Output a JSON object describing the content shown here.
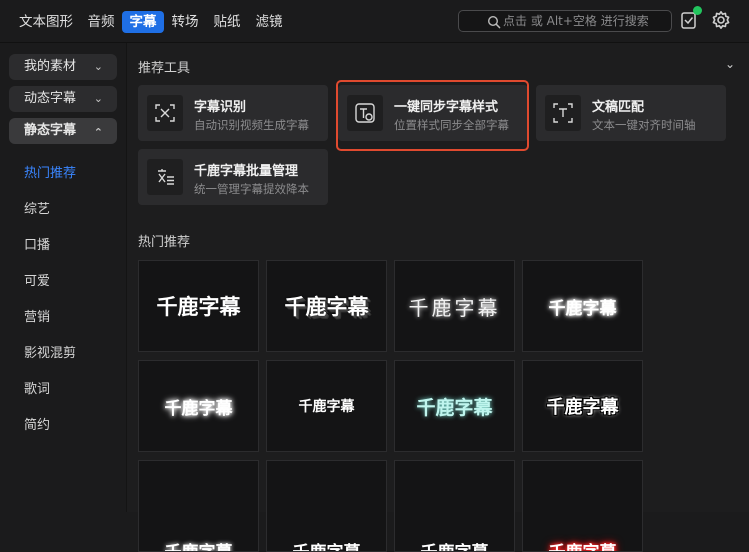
{
  "topbar": {
    "tabs": [
      {
        "label": "文本图形",
        "active": false
      },
      {
        "label": "音频",
        "active": false
      },
      {
        "label": "字幕",
        "active": true
      },
      {
        "label": "转场",
        "active": false
      },
      {
        "label": "贴纸",
        "active": false
      },
      {
        "label": "滤镜",
        "active": false
      }
    ],
    "search_placeholder": "点击 或 Alt+空格 进行搜索",
    "icons": [
      "search-icon",
      "task-check-icon",
      "settings-icon"
    ],
    "accent": "#1f6fe5",
    "badge_color": "#22c55e"
  },
  "sidebar": {
    "categories": [
      {
        "label": "我的素材",
        "expanded": false
      },
      {
        "label": "动态字幕",
        "expanded": false
      },
      {
        "label": "静态字幕",
        "expanded": true
      }
    ],
    "subitems": [
      {
        "label": "热门推荐",
        "active": true
      },
      {
        "label": "综艺",
        "active": false
      },
      {
        "label": "口播",
        "active": false
      },
      {
        "label": "可爱",
        "active": false
      },
      {
        "label": "营销",
        "active": false
      },
      {
        "label": "影视混剪",
        "active": false
      },
      {
        "label": "歌词",
        "active": false
      },
      {
        "label": "简约",
        "active": false
      }
    ],
    "active_color": "#3a86ff"
  },
  "main": {
    "tools_title": "推荐工具",
    "tools": [
      {
        "name": "字幕识别",
        "desc": "自动识别视频生成字幕",
        "icon": "subtitle-recognize-icon"
      },
      {
        "name": "一键同步字幕样式",
        "desc": "位置样式同步全部字幕",
        "icon": "sync-style-icon",
        "highlighted": true
      },
      {
        "name": "文稿匹配",
        "desc": "文本一键对齐时间轴",
        "icon": "text-match-icon"
      },
      {
        "name": "千鹿字幕批量管理",
        "desc": "统一管理字幕提效降本",
        "icon": "batch-manage-icon"
      }
    ],
    "highlight_color": "#e04a2f",
    "hot_title": "热门推荐",
    "preset_text": "千鹿字幕",
    "presets": [
      {
        "style": "plain-white"
      },
      {
        "style": "black-stroke-bold"
      },
      {
        "style": "thin-glow"
      },
      {
        "style": "white-glow"
      },
      {
        "style": "soft-glow-bold"
      },
      {
        "style": "small-white"
      },
      {
        "style": "mint-glow"
      },
      {
        "style": "white-black-outline"
      },
      {
        "style": "partial-1"
      },
      {
        "style": "partial-2"
      },
      {
        "style": "partial-3"
      },
      {
        "style": "red-glow"
      }
    ]
  }
}
